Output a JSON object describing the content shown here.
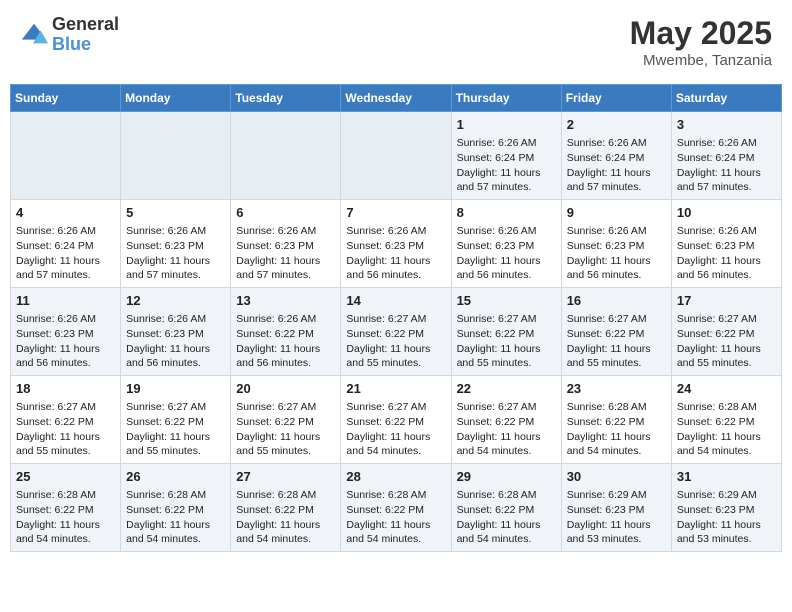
{
  "header": {
    "logo_line1": "General",
    "logo_line2": "Blue",
    "main_title": "May 2025",
    "subtitle": "Mwembe, Tanzania"
  },
  "days_of_week": [
    "Sunday",
    "Monday",
    "Tuesday",
    "Wednesday",
    "Thursday",
    "Friday",
    "Saturday"
  ],
  "weeks": [
    [
      {
        "day": "",
        "content": ""
      },
      {
        "day": "",
        "content": ""
      },
      {
        "day": "",
        "content": ""
      },
      {
        "day": "",
        "content": ""
      },
      {
        "day": "1",
        "content": "Sunrise: 6:26 AM\nSunset: 6:24 PM\nDaylight: 11 hours\nand 57 minutes."
      },
      {
        "day": "2",
        "content": "Sunrise: 6:26 AM\nSunset: 6:24 PM\nDaylight: 11 hours\nand 57 minutes."
      },
      {
        "day": "3",
        "content": "Sunrise: 6:26 AM\nSunset: 6:24 PM\nDaylight: 11 hours\nand 57 minutes."
      }
    ],
    [
      {
        "day": "4",
        "content": "Sunrise: 6:26 AM\nSunset: 6:24 PM\nDaylight: 11 hours\nand 57 minutes."
      },
      {
        "day": "5",
        "content": "Sunrise: 6:26 AM\nSunset: 6:23 PM\nDaylight: 11 hours\nand 57 minutes."
      },
      {
        "day": "6",
        "content": "Sunrise: 6:26 AM\nSunset: 6:23 PM\nDaylight: 11 hours\nand 57 minutes."
      },
      {
        "day": "7",
        "content": "Sunrise: 6:26 AM\nSunset: 6:23 PM\nDaylight: 11 hours\nand 56 minutes."
      },
      {
        "day": "8",
        "content": "Sunrise: 6:26 AM\nSunset: 6:23 PM\nDaylight: 11 hours\nand 56 minutes."
      },
      {
        "day": "9",
        "content": "Sunrise: 6:26 AM\nSunset: 6:23 PM\nDaylight: 11 hours\nand 56 minutes."
      },
      {
        "day": "10",
        "content": "Sunrise: 6:26 AM\nSunset: 6:23 PM\nDaylight: 11 hours\nand 56 minutes."
      }
    ],
    [
      {
        "day": "11",
        "content": "Sunrise: 6:26 AM\nSunset: 6:23 PM\nDaylight: 11 hours\nand 56 minutes."
      },
      {
        "day": "12",
        "content": "Sunrise: 6:26 AM\nSunset: 6:23 PM\nDaylight: 11 hours\nand 56 minutes."
      },
      {
        "day": "13",
        "content": "Sunrise: 6:26 AM\nSunset: 6:22 PM\nDaylight: 11 hours\nand 56 minutes."
      },
      {
        "day": "14",
        "content": "Sunrise: 6:27 AM\nSunset: 6:22 PM\nDaylight: 11 hours\nand 55 minutes."
      },
      {
        "day": "15",
        "content": "Sunrise: 6:27 AM\nSunset: 6:22 PM\nDaylight: 11 hours\nand 55 minutes."
      },
      {
        "day": "16",
        "content": "Sunrise: 6:27 AM\nSunset: 6:22 PM\nDaylight: 11 hours\nand 55 minutes."
      },
      {
        "day": "17",
        "content": "Sunrise: 6:27 AM\nSunset: 6:22 PM\nDaylight: 11 hours\nand 55 minutes."
      }
    ],
    [
      {
        "day": "18",
        "content": "Sunrise: 6:27 AM\nSunset: 6:22 PM\nDaylight: 11 hours\nand 55 minutes."
      },
      {
        "day": "19",
        "content": "Sunrise: 6:27 AM\nSunset: 6:22 PM\nDaylight: 11 hours\nand 55 minutes."
      },
      {
        "day": "20",
        "content": "Sunrise: 6:27 AM\nSunset: 6:22 PM\nDaylight: 11 hours\nand 55 minutes."
      },
      {
        "day": "21",
        "content": "Sunrise: 6:27 AM\nSunset: 6:22 PM\nDaylight: 11 hours\nand 54 minutes."
      },
      {
        "day": "22",
        "content": "Sunrise: 6:27 AM\nSunset: 6:22 PM\nDaylight: 11 hours\nand 54 minutes."
      },
      {
        "day": "23",
        "content": "Sunrise: 6:28 AM\nSunset: 6:22 PM\nDaylight: 11 hours\nand 54 minutes."
      },
      {
        "day": "24",
        "content": "Sunrise: 6:28 AM\nSunset: 6:22 PM\nDaylight: 11 hours\nand 54 minutes."
      }
    ],
    [
      {
        "day": "25",
        "content": "Sunrise: 6:28 AM\nSunset: 6:22 PM\nDaylight: 11 hours\nand 54 minutes."
      },
      {
        "day": "26",
        "content": "Sunrise: 6:28 AM\nSunset: 6:22 PM\nDaylight: 11 hours\nand 54 minutes."
      },
      {
        "day": "27",
        "content": "Sunrise: 6:28 AM\nSunset: 6:22 PM\nDaylight: 11 hours\nand 54 minutes."
      },
      {
        "day": "28",
        "content": "Sunrise: 6:28 AM\nSunset: 6:22 PM\nDaylight: 11 hours\nand 54 minutes."
      },
      {
        "day": "29",
        "content": "Sunrise: 6:28 AM\nSunset: 6:22 PM\nDaylight: 11 hours\nand 54 minutes."
      },
      {
        "day": "30",
        "content": "Sunrise: 6:29 AM\nSunset: 6:23 PM\nDaylight: 11 hours\nand 53 minutes."
      },
      {
        "day": "31",
        "content": "Sunrise: 6:29 AM\nSunset: 6:23 PM\nDaylight: 11 hours\nand 53 minutes."
      }
    ]
  ]
}
